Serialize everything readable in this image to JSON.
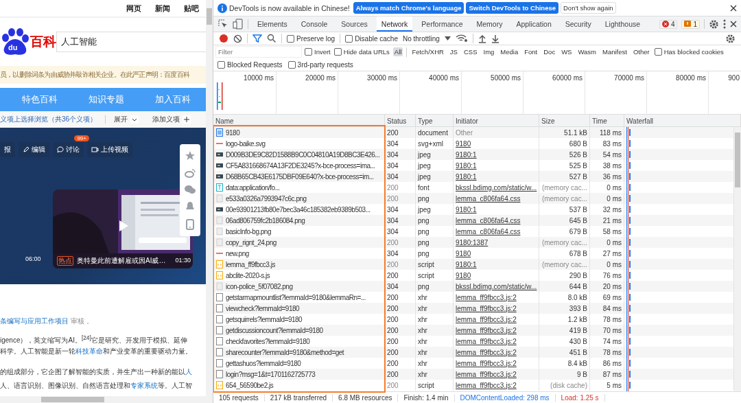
{
  "page": {
    "top_links": [
      "网页",
      "新闻",
      "贴吧"
    ],
    "logo": {
      "mark": "du",
      "name": "百科"
    },
    "search": {
      "value": "人工智能"
    },
    "notice": "员，以删除词条为由威胁并敲诈相关企业。在此严正声明：百度百科",
    "nav": [
      "特色百科",
      "知识专题",
      "加入百科"
    ],
    "sense_bar": {
      "text": "义项上选择浏览（共36个义项）",
      "expand": "展开",
      "add": "添加义项"
    },
    "actions": [
      {
        "label": "报",
        "kind": "plain"
      },
      {
        "label": "编辑",
        "kind": "edit"
      },
      {
        "label": "讨论",
        "kind": "discuss",
        "badge": "99+"
      },
      {
        "label": "上传视频",
        "kind": "video"
      }
    ],
    "side_time": "06:00",
    "video": {
      "tag": "热点",
      "title": "奥特曼此前遭解雇或因AI威…",
      "duration": "01:30"
    },
    "lines": [
      [
        {
          "text": "条编写与应用工作项目",
          "link": true
        },
        {
          "text": " 审核 。",
          "link": false
        }
      ],
      [
        {
          "text": "igence），英文缩写为AI。$^{[24]}$它是研究、开发用于模拟、延伸",
          "link": false
        }
      ],
      [
        {
          "text": "科学。人工智能是新一轮",
          "link": false
        },
        {
          "text": "科技革命",
          "link": true
        },
        {
          "text": "和产业变革的重要驱动力量。",
          "link": false
        }
      ],
      [
        {
          "text": "的组成部分，它企图了解智能的实质，并生产出一种新的能以",
          "link": false
        },
        {
          "text": "人",
          "link": true
        }
      ],
      [
        {
          "text": "人、语言识别、图像识别、自然语言处理和",
          "link": false
        },
        {
          "text": "专家系统",
          "link": true
        },
        {
          "text": "等。人工智",
          "link": false
        }
      ]
    ]
  },
  "devtools": {
    "infobar": {
      "message": "DevTools is now available in Chinese!",
      "buttons": [
        {
          "label": "Always match Chrome's language",
          "kind": "primary"
        },
        {
          "label": "Switch DevTools to Chinese",
          "kind": "primary"
        },
        {
          "label": "Don't show again",
          "kind": "plain"
        }
      ]
    },
    "tabs": [
      {
        "label": "Elements",
        "selected": false
      },
      {
        "label": "Console",
        "selected": false
      },
      {
        "label": "Sources",
        "selected": false
      },
      {
        "label": "Network",
        "selected": true
      },
      {
        "label": "Performance",
        "selected": false
      },
      {
        "label": "Memory",
        "selected": false
      },
      {
        "label": "Application",
        "selected": false
      },
      {
        "label": "Security",
        "selected": false
      },
      {
        "label": "Lighthouse",
        "selected": false
      }
    ],
    "errors": "4",
    "warnings": "1",
    "toolbar": {
      "recording": true,
      "preserve_log": {
        "label": "Preserve log",
        "checked": false
      },
      "disable_cache": {
        "label": "Disable cache",
        "checked": false
      },
      "throttling": "No throttling"
    },
    "filter": {
      "placeholder": "Filter",
      "invert": {
        "label": "Invert",
        "checked": false
      },
      "hide_data_urls": {
        "label": "Hide data URLs",
        "checked": false
      },
      "types": [
        {
          "label": "All",
          "selected": true
        },
        {
          "label": "Fetch/XHR",
          "selected": false
        },
        {
          "label": "JS",
          "selected": false
        },
        {
          "label": "CSS",
          "selected": false
        },
        {
          "label": "Img",
          "selected": false
        },
        {
          "label": "Media",
          "selected": false
        },
        {
          "label": "Font",
          "selected": false
        },
        {
          "label": "Doc",
          "selected": false
        },
        {
          "label": "WS",
          "selected": false
        },
        {
          "label": "Wasm",
          "selected": false
        },
        {
          "label": "Manifest",
          "selected": false
        },
        {
          "label": "Other",
          "selected": false
        }
      ],
      "has_blocked_cookies": {
        "label": "Has blocked cookies",
        "checked": false
      },
      "blocked_requests": {
        "label": "Blocked Requests",
        "checked": false
      },
      "third_party": {
        "label": "3rd-party requests",
        "checked": false
      }
    },
    "overview_ticks": [
      "10000 ms",
      "20000 ms",
      "30000 ms",
      "40000 ms",
      "50000 ms",
      "60000 ms",
      "70000 ms",
      "80000 ms",
      "900"
    ],
    "columns": [
      "Name",
      "Status",
      "Type",
      "Initiator",
      "Size",
      "Time",
      "Waterfall"
    ],
    "rows": [
      {
        "kind": "doc",
        "name": "9180",
        "status": "200",
        "cached": false,
        "type": "document",
        "initiator": "Other",
        "initiator_link": false,
        "size": "51.1 kB",
        "time": "118 ms"
      },
      {
        "kind": "svg",
        "name": "logo-baike.svg",
        "status": "304",
        "cached": false,
        "type": "svg+xml",
        "initiator": "9180",
        "initiator_link": true,
        "size": "680 B",
        "time": "83 ms"
      },
      {
        "kind": "img",
        "name": "D009B3DE9C82D1588B9C0C04810A19D8BC3E426...",
        "status": "304",
        "cached": false,
        "type": "jpeg",
        "initiator": "9180:1",
        "initiator_link": true,
        "size": "526 B",
        "time": "54 ms"
      },
      {
        "kind": "img",
        "name": "CF5A831668674A13F2DE3245?x-bce-process=ima...",
        "status": "304",
        "cached": false,
        "type": "jpeg",
        "initiator": "9180:1",
        "initiator_link": true,
        "size": "525 B",
        "time": "38 ms"
      },
      {
        "kind": "img",
        "name": "D68B65CB43E6175DBF09E640?x-bce-process=im...",
        "status": "304",
        "cached": false,
        "type": "jpeg",
        "initiator": "9180:1",
        "initiator_link": true,
        "size": "527 B",
        "time": "36 ms"
      },
      {
        "kind": "font",
        "name": "data:application/fo...",
        "status": "200",
        "cached": true,
        "type": "font",
        "initiator": "bkssl.bdimg.com/static/w...",
        "initiator_link": true,
        "size": "(memory cac...",
        "time": "0 ms"
      },
      {
        "kind": "png",
        "name": "e533a0326a7993947c6c.png",
        "status": "200",
        "cached": true,
        "type": "png",
        "initiator": "lemma_c806fa64.css",
        "initiator_link": true,
        "size": "(memory cac...",
        "time": "0 ms"
      },
      {
        "kind": "img",
        "name": "00e93901213fb80e7bec3a46c185382eb9389b503...",
        "status": "304",
        "cached": false,
        "type": "jpeg",
        "initiator": "9180:1",
        "initiator_link": true,
        "size": "537 B",
        "time": "32 ms"
      },
      {
        "kind": "png",
        "name": "06ad806759fc2b186084.png",
        "status": "304",
        "cached": false,
        "type": "png",
        "initiator": "lemma_c806fa64.css",
        "initiator_link": true,
        "size": "645 B",
        "time": "21 ms"
      },
      {
        "kind": "png",
        "name": "basicInfo-bg.png",
        "status": "304",
        "cached": false,
        "type": "png",
        "initiator": "lemma_c806fa64.css",
        "initiator_link": true,
        "size": "679 B",
        "time": "58 ms"
      },
      {
        "kind": "png",
        "name": "copy_rignt_24.png",
        "status": "200",
        "cached": true,
        "type": "png",
        "initiator": "9180:1387",
        "initiator_link": true,
        "size": "(memory cac...",
        "time": "0 ms"
      },
      {
        "kind": "svg",
        "name": "new.png",
        "status": "304",
        "cached": false,
        "type": "png",
        "initiator": "9180",
        "initiator_link": true,
        "size": "678 B",
        "time": "27 ms"
      },
      {
        "kind": "script",
        "name": "lemma_ff9fbcc3.js",
        "status": "200",
        "cached": true,
        "type": "script",
        "initiator": "9180:1",
        "initiator_link": true,
        "size": "(memory cac...",
        "time": "0 ms"
      },
      {
        "kind": "script",
        "name": "abclite-2020-s.js",
        "status": "200",
        "cached": false,
        "type": "script",
        "initiator": "9180",
        "initiator_link": true,
        "size": "290 B",
        "time": "76 ms"
      },
      {
        "kind": "png",
        "name": "icon-police_5f07082.png",
        "status": "304",
        "cached": false,
        "type": "png",
        "initiator": "bkssl.bdimg.com/static/w...",
        "initiator_link": true,
        "size": "644 B",
        "time": "20 ms"
      },
      {
        "kind": "xhr",
        "name": "getstarmapmountlist?lemmaId=9180&lemmaRn=...",
        "status": "200",
        "cached": false,
        "type": "xhr",
        "initiator": "lemma_ff9fbcc3.js:2",
        "initiator_link": true,
        "size": "8.0 kB",
        "time": "69 ms"
      },
      {
        "kind": "xhr",
        "name": "viewcheck?lemmaId=9180",
        "status": "200",
        "cached": false,
        "type": "xhr",
        "initiator": "lemma_ff9fbcc3.js:2",
        "initiator_link": true,
        "size": "393 B",
        "time": "84 ms"
      },
      {
        "kind": "xhr",
        "name": "getsquirrels?lemmaId=9180",
        "status": "200",
        "cached": false,
        "type": "xhr",
        "initiator": "lemma_ff9fbcc3.js:2",
        "initiator_link": true,
        "size": "1.2 kB",
        "time": "78 ms"
      },
      {
        "kind": "xhr",
        "name": "getdiscussioncount?lemmaId=9180",
        "status": "200",
        "cached": false,
        "type": "xhr",
        "initiator": "lemma_ff9fbcc3.js:2",
        "initiator_link": true,
        "size": "419 B",
        "time": "70 ms"
      },
      {
        "kind": "xhr",
        "name": "checkfavorites?lemmaId=9180",
        "status": "200",
        "cached": false,
        "type": "xhr",
        "initiator": "lemma_ff9fbcc3.js:2",
        "initiator_link": true,
        "size": "430 B",
        "time": "74 ms"
      },
      {
        "kind": "xhr",
        "name": "sharecounter?lemmaId=9180&method=get",
        "status": "200",
        "cached": false,
        "type": "xhr",
        "initiator": "lemma_ff9fbcc3.js:2",
        "initiator_link": true,
        "size": "451 B",
        "time": "78 ms"
      },
      {
        "kind": "xhr",
        "name": "gettashuos?lemmaId=9180",
        "status": "200",
        "cached": false,
        "type": "xhr",
        "initiator": "lemma_ff9fbcc3.js:2",
        "initiator_link": true,
        "size": "8.4 kB",
        "time": "86 ms"
      },
      {
        "kind": "xhr",
        "name": "login?msg=1&t=1701162725773",
        "status": "200",
        "cached": false,
        "type": "xhr",
        "initiator": "lemma_ff9fbcc3.js:2",
        "initiator_link": true,
        "size": "9 B",
        "time": "87 ms"
      },
      {
        "kind": "script",
        "name": "654_56590be2.js",
        "status": "200",
        "cached": true,
        "type": "script",
        "initiator": "lemma_ff9fbcc3.js:2",
        "initiator_link": true,
        "size": "(disk cache)",
        "time": "5 ms"
      }
    ],
    "status_bar": [
      {
        "text": "105 requests",
        "kind": "plain"
      },
      {
        "text": "217 kB transferred",
        "kind": "plain"
      },
      {
        "text": "6.8 MB resources",
        "kind": "plain"
      },
      {
        "text": "Finish: 1.4 min",
        "kind": "plain"
      },
      {
        "text": "DOMContentLoaded: 298 ms",
        "kind": "dom"
      },
      {
        "text": "Load: 1.25 s",
        "kind": "load"
      }
    ]
  }
}
